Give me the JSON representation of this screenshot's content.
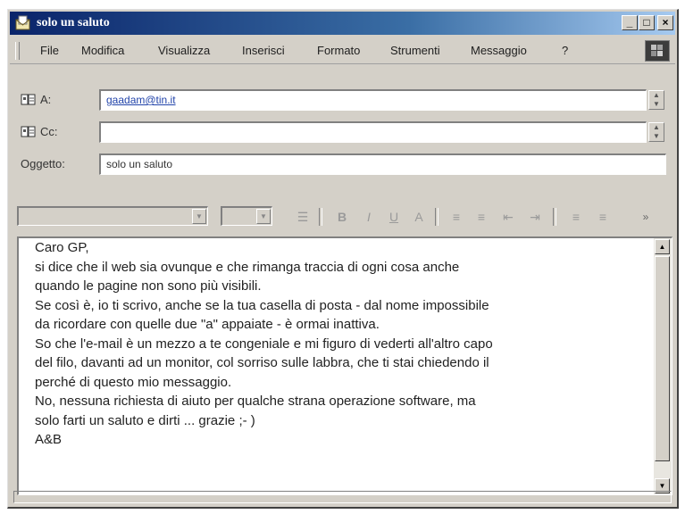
{
  "window": {
    "title": "solo un saluto",
    "icon": "envelope-letter-icon",
    "controls": {
      "minimize": "_",
      "maximize": "□",
      "close": "×"
    }
  },
  "menu": {
    "items": [
      {
        "label": "File",
        "accel": "F"
      },
      {
        "label": "Modifica",
        "accel": "M"
      },
      {
        "label": "Visualizza",
        "accel": "V"
      },
      {
        "label": "Inserisci",
        "accel": "I"
      },
      {
        "label": "Formato",
        "accel": "o"
      },
      {
        "label": "Strumenti",
        "accel": "S"
      },
      {
        "label": "Messaggio",
        "accel": "e"
      },
      {
        "label": "?",
        "accel": "?"
      }
    ]
  },
  "header": {
    "to_label": "A:",
    "to_value": "gaadam@tin.it",
    "cc_label": "Cc:",
    "cc_value": "",
    "subject_label": "Oggetto:",
    "subject_value": "solo un saluto"
  },
  "message": {
    "lines": [
      "Caro GP,",
      "si dice che il web sia ovunque e che rimanga traccia di ogni cosa anche",
      "quando le pagine non sono più visibili.",
      "Se così è, io ti scrivo, anche se la tua casella di posta - dal nome impossibile",
      "da ricordare con quelle due \"a\" appaiate - è ormai inattiva.",
      "So che l'e-mail è un mezzo a te congeniale e mi figuro di vederti all'altro capo",
      "del filo, davanti ad un monitor, col sorriso sulle labbra, che ti stai chiedendo il",
      "perché di questo mio messaggio.",
      "No, nessuna richiesta di aiuto per qualche strana operazione software, ma",
      "solo farti un saluto e dirti ... grazie  ;- )",
      "A&B"
    ]
  },
  "colors": {
    "titlebar_start": "#0a246a",
    "titlebar_end": "#a6caf0",
    "chrome": "#d4d0c8",
    "link": "#2244aa"
  }
}
